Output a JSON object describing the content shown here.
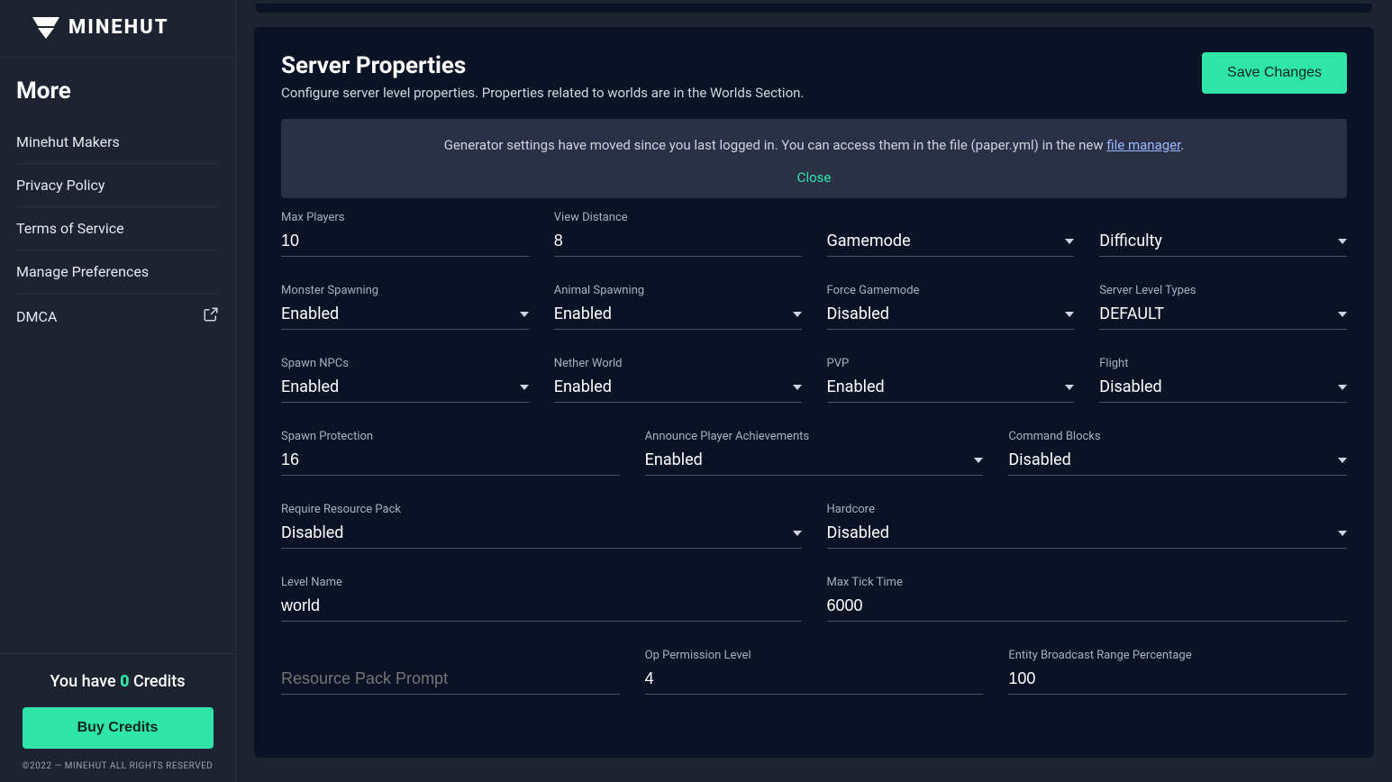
{
  "brand": {
    "name": "MINEHUT"
  },
  "sidebar": {
    "heading": "More",
    "items": [
      {
        "label": "Minehut Makers"
      },
      {
        "label": "Privacy Policy"
      },
      {
        "label": "Terms of Service"
      },
      {
        "label": "Manage Preferences"
      },
      {
        "label": "DMCA",
        "external": true
      }
    ],
    "credits": {
      "prefix": "You have ",
      "count": "0",
      "suffix": " Credits"
    },
    "buy_label": "Buy Credits",
    "copyright": "©2022 — MINEHUT ALL RIGHTS RESERVED"
  },
  "page": {
    "title": "Server Properties",
    "subtitle": "Configure server level properties. Properties related to worlds are in the Worlds Section.",
    "save_label": "Save Changes",
    "notice": {
      "text_before_link": "Generator settings have moved since you last logged in. You can access them in the file (paper.yml) in the new ",
      "link_text": "file manager",
      "text_after_link": ".",
      "close_label": "Close"
    }
  },
  "fields": {
    "max_players": {
      "label": "Max Players",
      "value": "10",
      "type": "text"
    },
    "view_distance": {
      "label": "View Distance",
      "value": "8",
      "type": "text"
    },
    "gamemode": {
      "label": "",
      "value": "Gamemode",
      "type": "select"
    },
    "difficulty": {
      "label": "",
      "value": "Difficulty",
      "type": "select"
    },
    "monster_spawn": {
      "label": "Monster Spawning",
      "value": "Enabled",
      "type": "select"
    },
    "animal_spawn": {
      "label": "Animal Spawning",
      "value": "Enabled",
      "type": "select"
    },
    "force_gamemode": {
      "label": "Force Gamemode",
      "value": "Disabled",
      "type": "select"
    },
    "level_types": {
      "label": "Server Level Types",
      "value": "DEFAULT",
      "type": "select"
    },
    "spawn_npcs": {
      "label": "Spawn NPCs",
      "value": "Enabled",
      "type": "select"
    },
    "nether_world": {
      "label": "Nether World",
      "value": "Enabled",
      "type": "select"
    },
    "pvp": {
      "label": "PVP",
      "value": "Enabled",
      "type": "select"
    },
    "flight": {
      "label": "Flight",
      "value": "Disabled",
      "type": "select"
    },
    "spawn_protection": {
      "label": "Spawn Protection",
      "value": "16",
      "type": "text"
    },
    "announce_ach": {
      "label": "Announce Player Achievements",
      "value": "Enabled",
      "type": "select"
    },
    "command_blocks": {
      "label": "Command Blocks",
      "value": "Disabled",
      "type": "select"
    },
    "require_rp": {
      "label": "Require Resource Pack",
      "value": "Disabled",
      "type": "select"
    },
    "hardcore": {
      "label": "Hardcore",
      "value": "Disabled",
      "type": "select"
    },
    "level_name": {
      "label": "Level Name",
      "value": "world",
      "type": "text"
    },
    "max_tick_time": {
      "label": "Max Tick Time",
      "value": "6000",
      "type": "text"
    },
    "rp_prompt": {
      "label": "",
      "placeholder": "Resource Pack Prompt",
      "type": "text"
    },
    "op_perm": {
      "label": "Op Permission Level",
      "value": "4",
      "type": "text"
    },
    "entity_broadcast": {
      "label": "Entity Broadcast Range Percentage",
      "value": "100",
      "type": "text"
    }
  }
}
